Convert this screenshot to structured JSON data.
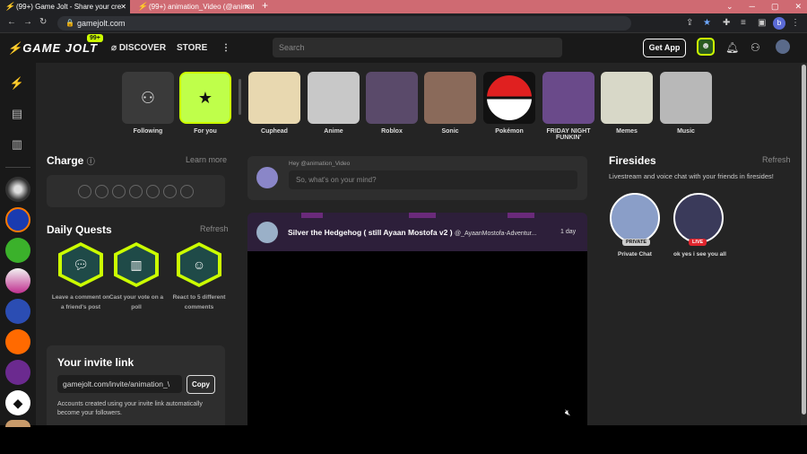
{
  "browser": {
    "tabs": [
      {
        "label": "(99+) Game Jolt - Share your cre"
      },
      {
        "label": "(99+) animation_Video (@animati"
      }
    ],
    "url": "gamejolt.com"
  },
  "header": {
    "logo": "GAME JOLT",
    "badge": "99+",
    "nav": [
      "DISCOVER",
      "STORE"
    ],
    "search_placeholder": "Search",
    "get_app": "Get App"
  },
  "communities": [
    {
      "label": "Following"
    },
    {
      "label": "For you"
    },
    {
      "label": "Cuphead"
    },
    {
      "label": "Anime"
    },
    {
      "label": "Roblox"
    },
    {
      "label": "Sonic"
    },
    {
      "label": "Pokémon"
    },
    {
      "label": "FRIDAY NIGHT FUNKIN'"
    },
    {
      "label": "Memes"
    },
    {
      "label": "Music"
    }
  ],
  "charge": {
    "title": "Charge",
    "learn_more": "Learn more"
  },
  "quests": {
    "title": "Daily Quests",
    "refresh": "Refresh",
    "items": [
      {
        "text": "Leave a comment on a friend's post"
      },
      {
        "text": "Cast your vote on a poll"
      },
      {
        "text": "React to 5 different comments"
      }
    ]
  },
  "invite": {
    "title": "Your invite link",
    "link": "gamejolt.com/invite/animation_\\",
    "copy": "Copy",
    "note": "Accounts created using your invite link automatically become your followers."
  },
  "composer": {
    "greeting": "Hey @animation_Video",
    "placeholder": "So, what's on your mind?"
  },
  "post": {
    "title": "Silver the Hedgehog ( still Ayaan Mostofa v2 )",
    "author": "@_AyaanMostofa-Adventur...",
    "time": "1 day"
  },
  "firesides": {
    "title": "Firesides",
    "refresh": "Refresh",
    "subtitle": "Livestream and voice chat with your friends in firesides!",
    "items": [
      {
        "label": "Private Chat",
        "badge": "PRIVATE"
      },
      {
        "label": "ok yes i see you all",
        "badge": "LIVE"
      }
    ]
  },
  "colors": {
    "accent": "#ccff00",
    "live": "#e0252d",
    "bg": "#242424"
  }
}
